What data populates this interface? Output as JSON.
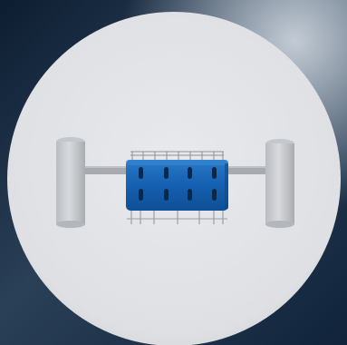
{
  "scene": {
    "icon": "offshore-platform-icon",
    "colors": {
      "background_dark": "#16283d",
      "background_light": "#c9d2dc",
      "disc": "#e3e4e7",
      "module_blue": "#1560b0",
      "module_highlight": "#2a78c8",
      "tower": "#cfd1d4",
      "tower_shade": "#a9acb1",
      "beam": "#a7aaae",
      "window": "#0c2846",
      "rail": "#8d9095"
    }
  }
}
